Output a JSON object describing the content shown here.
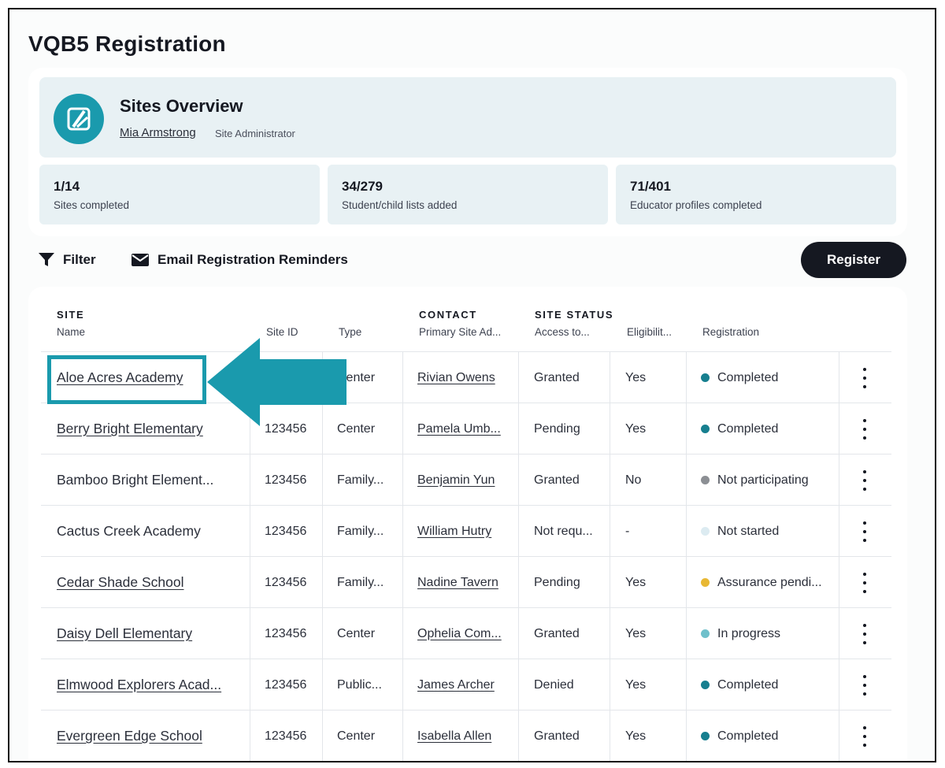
{
  "page": {
    "title": "VQB5 Registration"
  },
  "overview": {
    "title": "Sites Overview",
    "user_name": "Mia Armstrong",
    "user_role": "Site Administrator",
    "logo_icon": "brand-logo-icon"
  },
  "stats": [
    {
      "value": "1/14",
      "label": "Sites completed"
    },
    {
      "value": "34/279",
      "label": "Student/child lists added"
    },
    {
      "value": "71/401",
      "label": "Educator profiles completed"
    }
  ],
  "toolbar": {
    "filter_label": "Filter",
    "email_label": "Email Registration Reminders",
    "register_label": "Register"
  },
  "table": {
    "groups": {
      "site": "SITE",
      "contact": "CONTACT",
      "site_status": "SITE STATUS"
    },
    "columns": {
      "name": "Name",
      "site_id": "Site ID",
      "type": "Type",
      "primary": "Primary Site Ad...",
      "access": "Access to...",
      "eligibility": "Eligibilit...",
      "registration": "Registration"
    },
    "rows": [
      {
        "name": "Aloe Acres Academy",
        "site_id": "",
        "type": "Center",
        "contact": "Rivian Owens",
        "access": "Granted",
        "eligibility": "Yes",
        "registration": "Completed",
        "status_color": "#177f8f"
      },
      {
        "name": "Berry Bright Elementary",
        "site_id": "123456",
        "type": "Center",
        "contact": "Pamela Umb...",
        "access": "Pending",
        "eligibility": "Yes",
        "registration": "Completed",
        "status_color": "#177f8f"
      },
      {
        "name": "Bamboo Bright Element...",
        "site_id": "123456",
        "type": "Family...",
        "contact": "Benjamin Yun",
        "access": "Granted",
        "eligibility": "No",
        "registration": "Not participating",
        "status_color": "#8c8f94"
      },
      {
        "name": "Cactus Creek Academy",
        "site_id": "123456",
        "type": "Family...",
        "contact": "William Hutry",
        "access": "Not requ...",
        "eligibility": "-",
        "registration": "Not started",
        "status_color": "#dcebf1"
      },
      {
        "name": "Cedar Shade School",
        "site_id": "123456",
        "type": "Family...",
        "contact": "Nadine Tavern",
        "access": "Pending",
        "eligibility": "Yes",
        "registration": "Assurance pendi...",
        "status_color": "#e8b834"
      },
      {
        "name": "Daisy Dell Elementary",
        "site_id": "123456",
        "type": "Center",
        "contact": "Ophelia Com...",
        "access": "Granted",
        "eligibility": "Yes",
        "registration": "In progress",
        "status_color": "#6fc0cb"
      },
      {
        "name": "Elmwood Explorers Acad...",
        "site_id": "123456",
        "type": "Public...",
        "contact": "James Archer",
        "access": "Denied",
        "eligibility": "Yes",
        "registration": "Completed",
        "status_color": "#177f8f"
      },
      {
        "name": "Evergreen Edge School",
        "site_id": "123456",
        "type": "Center",
        "contact": "Isabella Allen",
        "access": "Granted",
        "eligibility": "Yes",
        "registration": "Completed",
        "status_color": "#177f8f"
      }
    ]
  },
  "colors": {
    "accent": "#1a9aad",
    "dark": "#151821",
    "panel": "#e8f1f4"
  }
}
